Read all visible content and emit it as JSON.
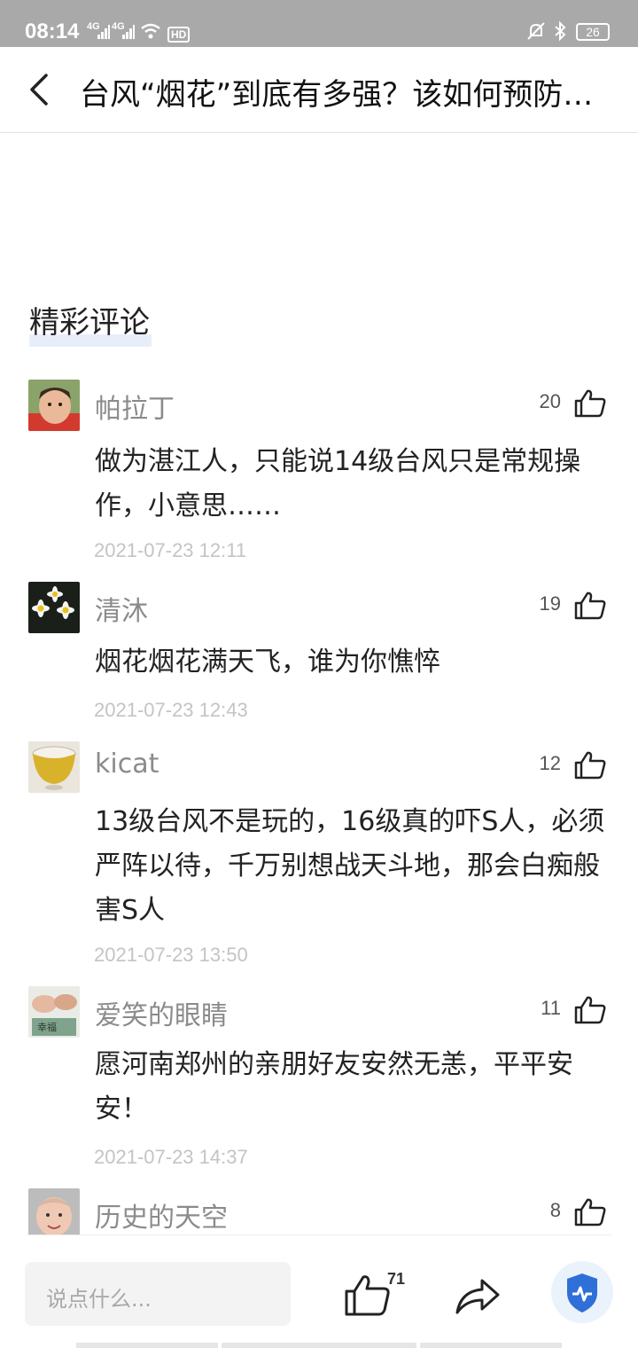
{
  "status_bar": {
    "time": "08:14",
    "signal1": "4G",
    "signal2": "4G",
    "hd": "HD",
    "battery": "26"
  },
  "header": {
    "title": "台风“烟花”到底有多强？该如何预防台…"
  },
  "section": {
    "title": "精彩评论"
  },
  "comments": [
    {
      "name": "帕拉丁",
      "likes": "20",
      "text": "做为湛江人，只能说14级台风只是常规操作，小意思……",
      "time": "2021-07-23 12:11"
    },
    {
      "name": "清沐",
      "likes": "19",
      "text": "烟花烟花满天飞，谁为你憔悴",
      "time": "2021-07-23 12:43"
    },
    {
      "name": "kicat",
      "likes": "12",
      "text": "13级台风不是玩的，16级真的吓S人，必须严阵以待，千万别想战天斗地，那会白痴般害S人",
      "time": "2021-07-23 13:50"
    },
    {
      "name": "爱笑的眼睛",
      "likes": "11",
      "text": "愿河南郑州的亲朋好友安然无恙，平平安安！",
      "time": "2021-07-23 14:37"
    },
    {
      "name": "历史的天空",
      "likes": "8",
      "text": "",
      "time": ""
    }
  ],
  "bottom_bar": {
    "input_placeholder": "说点什么...",
    "like_count": "71"
  },
  "colors": {
    "status_bar_bg": "#a9a9a9",
    "name_gray": "#8b8b8b",
    "time_gray": "#c4c4c4",
    "accent_blue": "#2e6fd8"
  },
  "icons": {
    "back": "chevron-left-icon",
    "like": "thumbs-up-icon",
    "share": "share-arrow-icon",
    "health": "heart-pulse-shield-icon"
  }
}
